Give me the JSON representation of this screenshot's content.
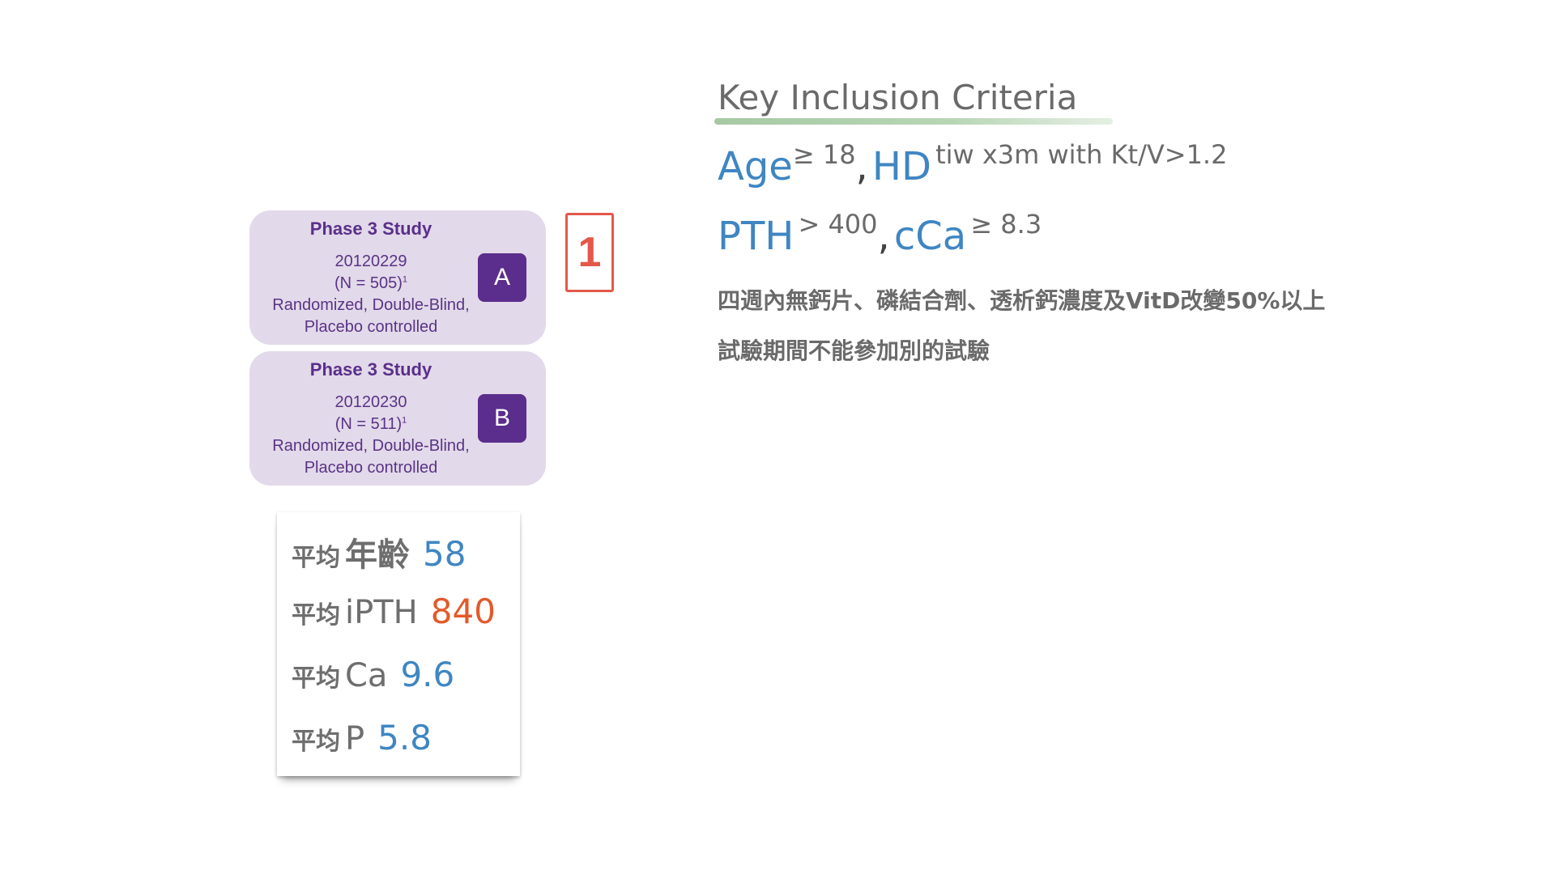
{
  "studies": [
    {
      "title": "Phase 3 Study",
      "id": "20120229",
      "n": "(N = 505)",
      "footnote": "1",
      "design_line1": "Randomized, Double-Blind,",
      "design_line2": "Placebo controlled",
      "letter": "A"
    },
    {
      "title": "Phase 3 Study",
      "id": "20120230",
      "n": "(N = 511)",
      "footnote": "1",
      "design_line1": "Randomized, Double-Blind,",
      "design_line2": "Placebo controlled",
      "letter": "B"
    }
  ],
  "callout": {
    "number": "1"
  },
  "stats": [
    {
      "prefix": "平均",
      "label": "年齡",
      "value": "58"
    },
    {
      "prefix": "平均",
      "label": "iPTH",
      "value": "840"
    },
    {
      "prefix": "平均",
      "label": "Ca",
      "value": "9.6"
    },
    {
      "prefix": "平均",
      "label": "P",
      "value": "5.8"
    }
  ],
  "criteria": {
    "title": "Key Inclusion Criteria",
    "line1": {
      "age": "Age",
      "age_cond": "≥ 18",
      "comma": ",",
      "hd": "HD",
      "hd_cond": "tiw x3m with Kt/V>1.2"
    },
    "line2": {
      "pth": "PTH",
      "pth_cond": "> 400",
      "comma": ",",
      "cca": "cCa",
      "cca_cond": "≥ 8.3"
    },
    "note1": "四週內無鈣片、磷結合劑、透析鈣濃度及VitD改變50%以上",
    "note2": "試驗期間不能參加別的試驗"
  },
  "colors": {
    "card_bg": "#e2d9ea",
    "card_text": "#5a3485",
    "letter_bg": "#5b2d8c",
    "blue": "#3f86c2",
    "orange": "#e25a2b",
    "red_callout": "#e4584a",
    "gray_text": "#6a6a6a",
    "underline_green": "#a6c9a4"
  }
}
